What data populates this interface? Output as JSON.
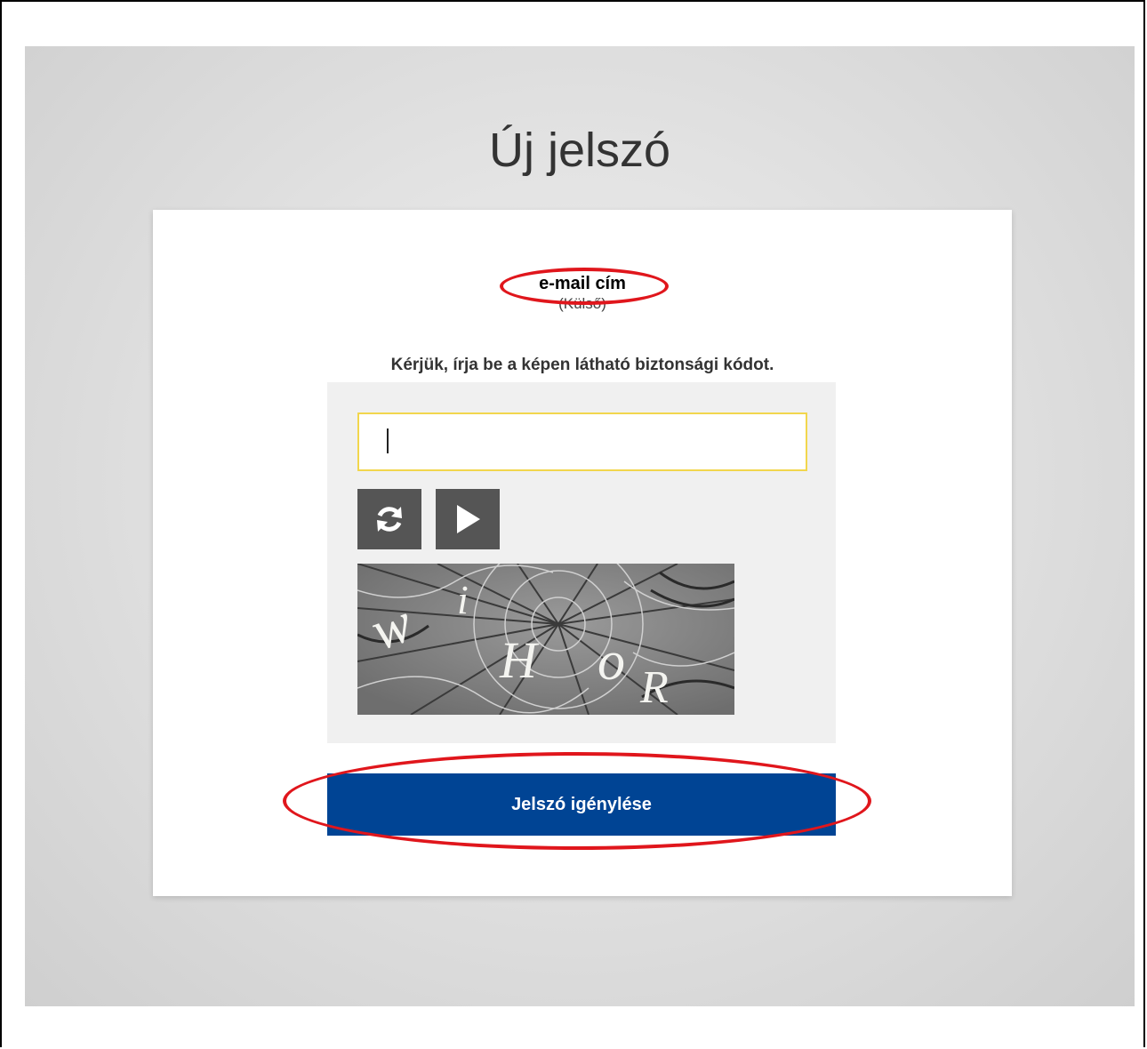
{
  "page": {
    "title": "Új jelszó"
  },
  "form": {
    "email_label": "e-mail cím",
    "email_sub": "(Külső)",
    "captcha_prompt": "Kérjük, írja be a képen látható biztonsági kódot.",
    "captcha_input_value": "",
    "captcha_image_text": "wiHoR",
    "refresh_icon": "refresh-icon",
    "play_icon": "play-icon",
    "submit_label": "Jelszó igénylése"
  },
  "colors": {
    "submit_bg": "#004494",
    "control_bg": "#555555",
    "input_border": "#f2d64d",
    "annotation_red": "#e0161c"
  }
}
